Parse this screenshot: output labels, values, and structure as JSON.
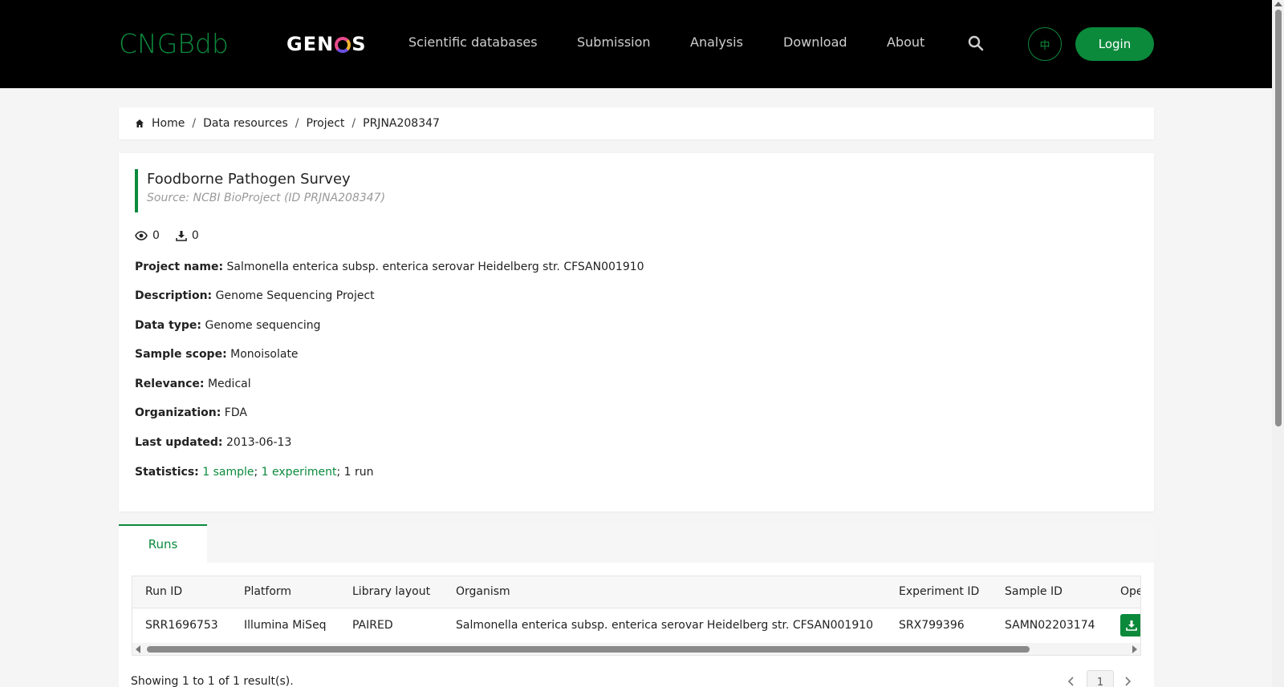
{
  "header": {
    "logo_cngb": "CNGBdb",
    "logo_genos_left": "GEN",
    "logo_genos_right": "S",
    "nav": [
      {
        "label": "Scientific databases"
      },
      {
        "label": "Submission"
      },
      {
        "label": "Analysis"
      },
      {
        "label": "Download"
      },
      {
        "label": "About"
      }
    ],
    "lang_label": "中",
    "login_label": "Login",
    "accent_color": "#0b8a3c"
  },
  "breadcrumb": {
    "items": [
      "Home",
      "Data resources",
      "Project",
      "PRJNA208347"
    ],
    "separator": "/"
  },
  "project": {
    "title": "Foodborne Pathogen Survey",
    "source": "Source: NCBI BioProject (ID PRJNA208347)",
    "views": "0",
    "downloads": "0",
    "fields": [
      {
        "label": "Project name:",
        "value": "Salmonella enterica subsp. enterica serovar Heidelberg str. CFSAN001910"
      },
      {
        "label": "Description:",
        "value": "Genome Sequencing Project"
      },
      {
        "label": "Data type:",
        "value": "Genome sequencing"
      },
      {
        "label": "Sample scope:",
        "value": "Monoisolate"
      },
      {
        "label": "Relevance:",
        "value": "Medical"
      },
      {
        "label": "Organization:",
        "value": "FDA"
      },
      {
        "label": "Last updated:",
        "value": "2013-06-13"
      }
    ],
    "statistics": {
      "label": "Statistics:",
      "samples": "1 sample",
      "sep1": ";",
      "experiments": "1 experiment",
      "runs": "; 1 run"
    }
  },
  "tabs": {
    "active": "Runs"
  },
  "runs_table": {
    "columns": [
      "Run ID",
      "Platform",
      "Library layout",
      "Organism",
      "Experiment ID",
      "Sample ID",
      "Ope"
    ],
    "rows": [
      {
        "run_id": "SRR1696753",
        "platform": "Illumina MiSeq",
        "layout": "PAIRED",
        "organism": "Salmonella enterica subsp. enterica serovar Heidelberg str. CFSAN001910",
        "experiment_id": "SRX799396",
        "sample_id": "SAMN02203174"
      }
    ]
  },
  "pagination": {
    "showing": "Showing 1 to 1 of 1 result(s).",
    "current_page": "1"
  }
}
